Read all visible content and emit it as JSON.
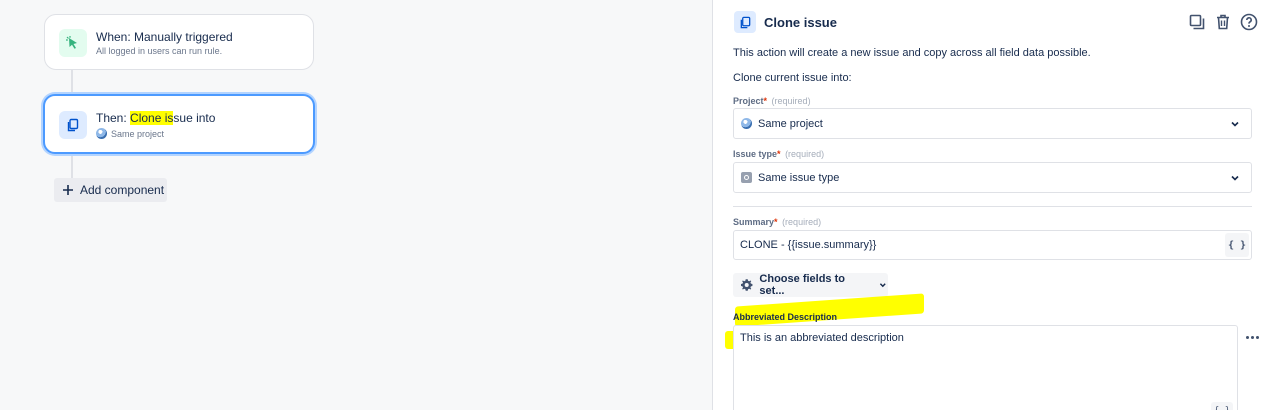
{
  "canvas": {
    "trigger": {
      "title": "When: Manually triggered",
      "subtitle": "All logged in users can run rule."
    },
    "action": {
      "title_prefix": "Then: ",
      "title_highlight": "Clone is",
      "title_suffix": "sue into",
      "subtitle": "Same project"
    },
    "add_component_label": "Add component"
  },
  "panel": {
    "title": "Clone issue",
    "description": "This action will create a new issue and copy across all field data possible.",
    "clone_into": "Clone current issue into:",
    "project": {
      "label": "Project",
      "required_star": "*",
      "required_hint": "(required)",
      "value": "Same project"
    },
    "issue_type": {
      "label": "Issue type",
      "required_star": "*",
      "required_hint": "(required)",
      "value": "Same issue type"
    },
    "summary": {
      "label": "Summary",
      "required_star": "*",
      "required_hint": "(required)",
      "value": "CLONE - {{issue.summary}}",
      "smart_value_button": "{ }"
    },
    "choose_fields_label": "Choose fields to set...",
    "abbreviated_description": {
      "label": "Abbreviated Description",
      "value": "This is an abbreviated description",
      "smart_value_button": "{ }"
    }
  },
  "colors": {
    "accent": "#4c9aff",
    "highlight": "#ffff00",
    "trigger_icon_bg": "#e3fcef",
    "trigger_icon": "#36b37e",
    "action_icon_bg": "#deebff",
    "action_icon": "#0052cc"
  },
  "icons": {
    "trigger": "cursor-click-icon",
    "action": "copy-icon",
    "project": "project-avatar-icon",
    "issue_type": "issue-type-icon",
    "duplicate": "duplicate-icon",
    "delete": "trash-icon",
    "help": "help-icon",
    "settings": "gear-icon"
  }
}
